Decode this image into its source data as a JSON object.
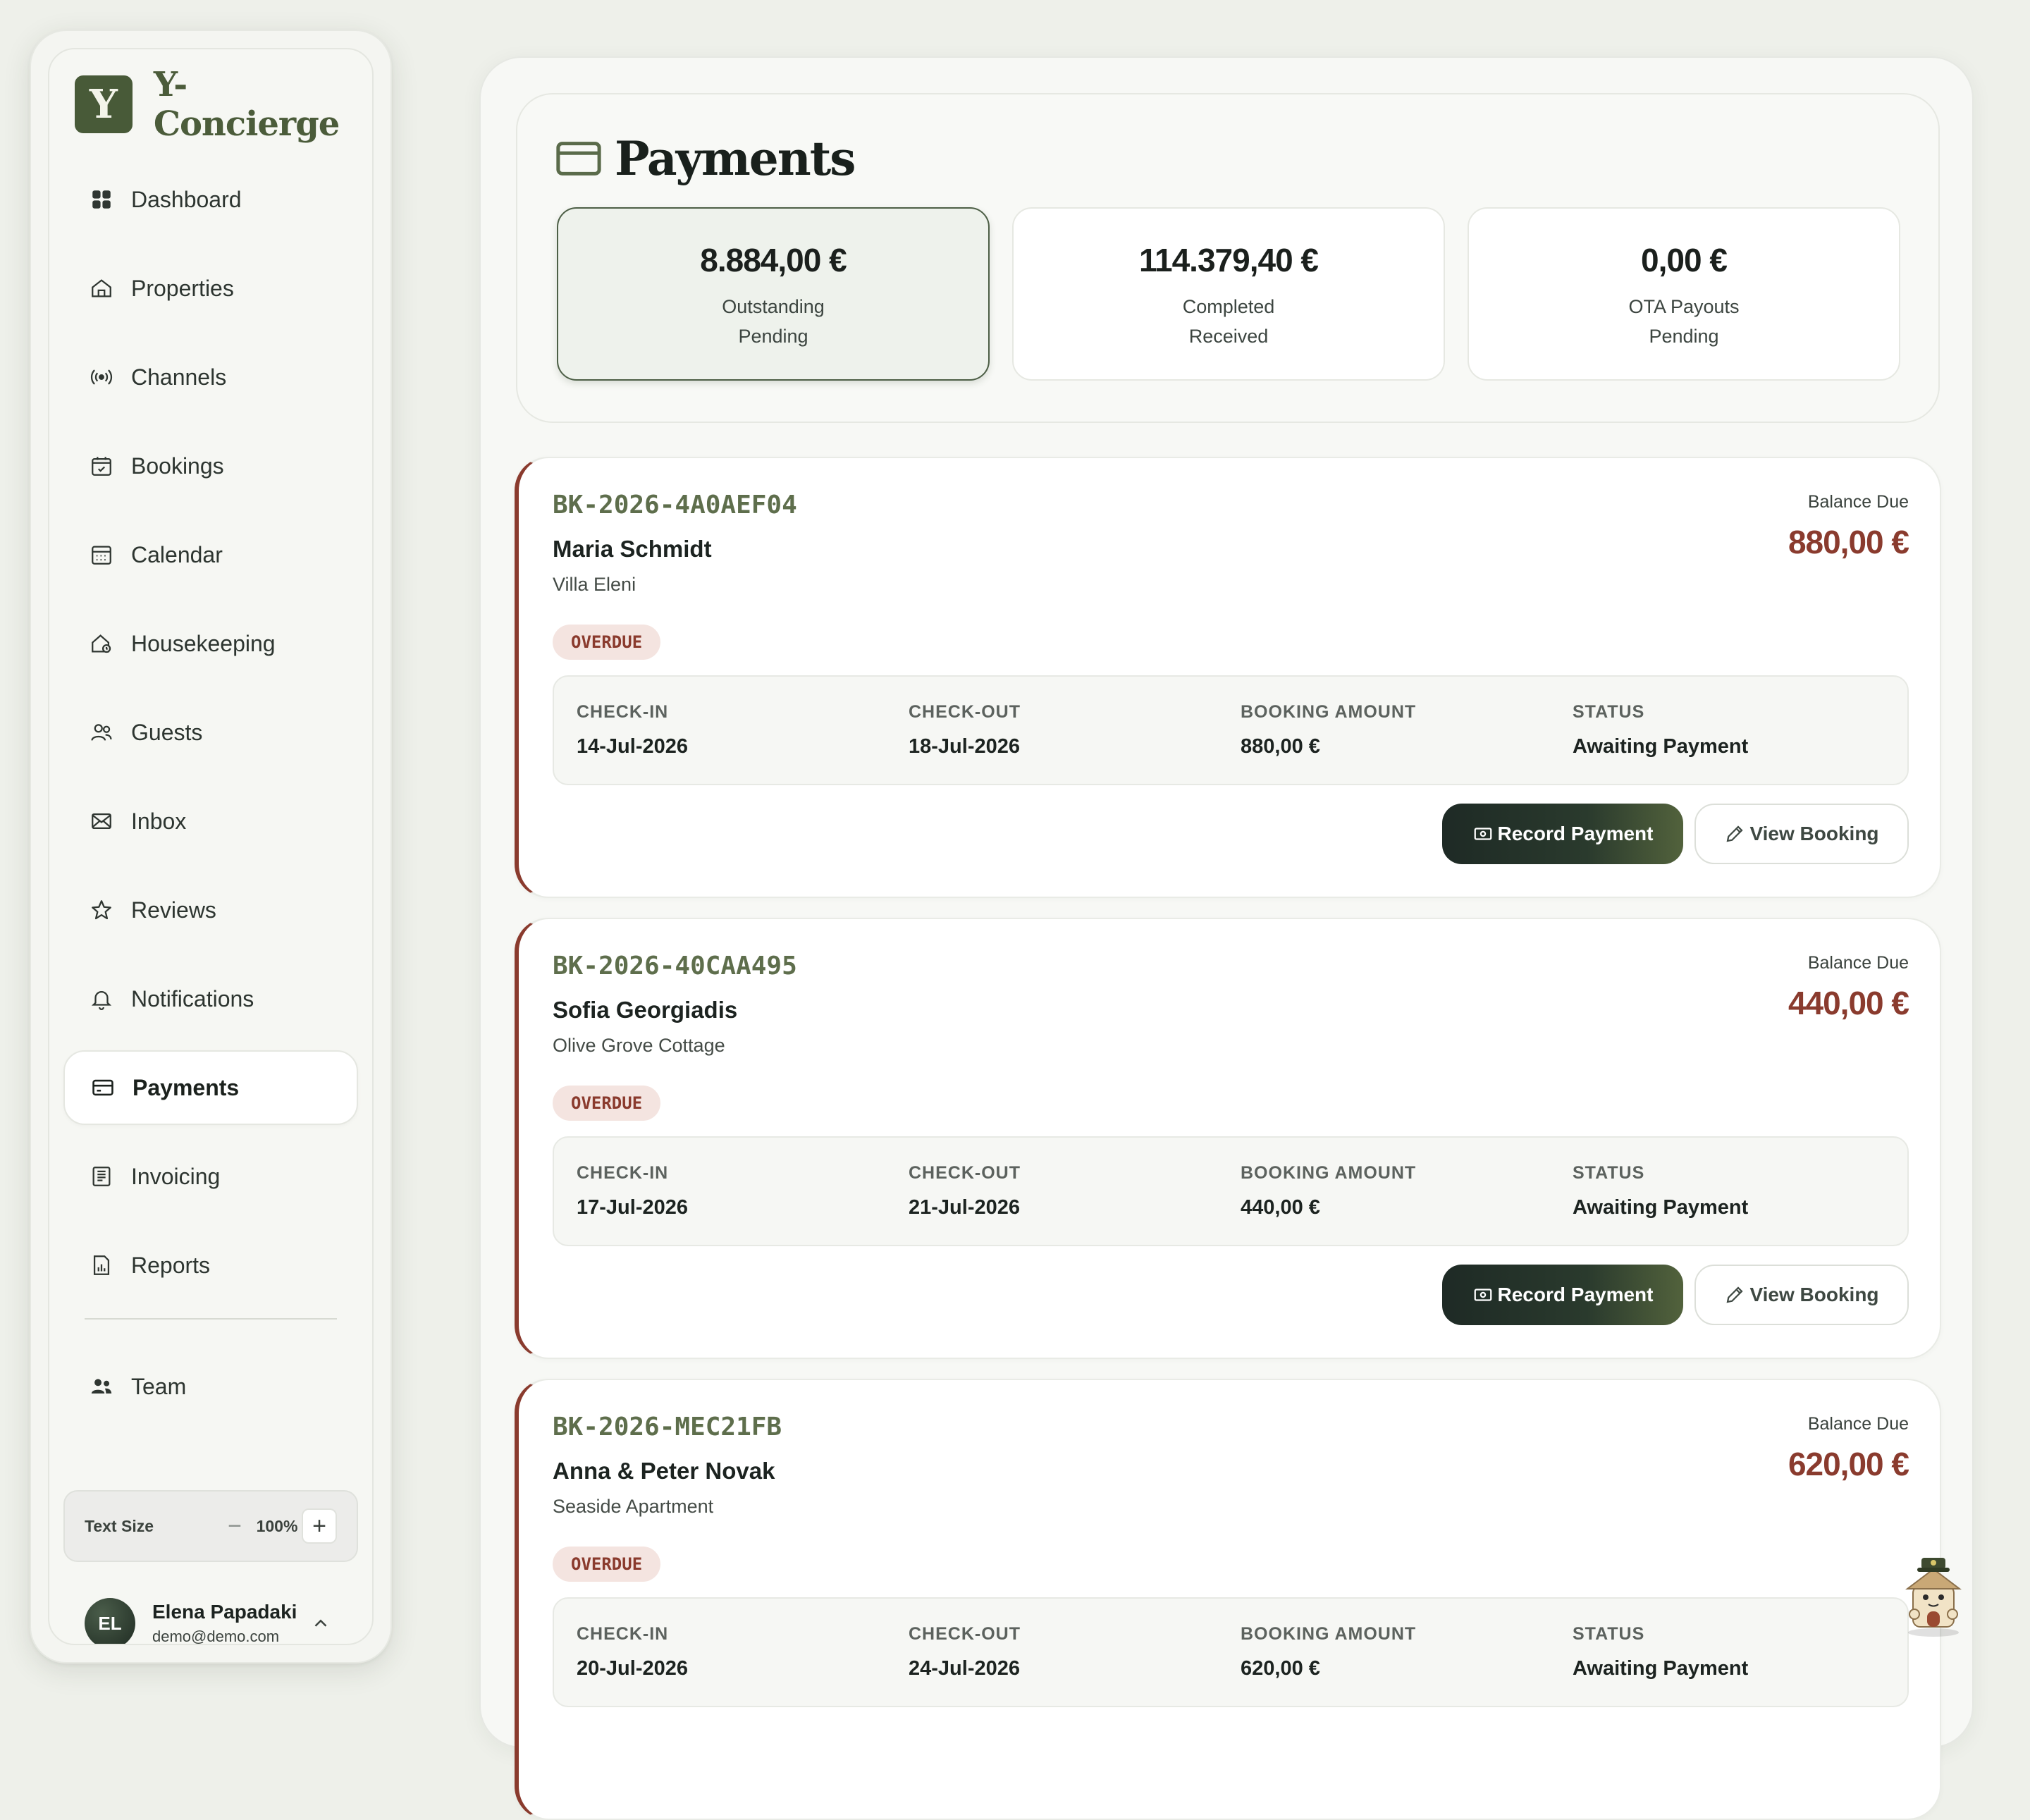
{
  "brand": {
    "logo_letter": "Y",
    "name": "Y-Concierge",
    "color": "#485a38"
  },
  "sidebar": {
    "items": [
      {
        "label": "Dashboard",
        "icon": "dashboard-icon"
      },
      {
        "label": "Properties",
        "icon": "home-icon"
      },
      {
        "label": "Channels",
        "icon": "broadcast-icon"
      },
      {
        "label": "Bookings",
        "icon": "calendar-check-icon"
      },
      {
        "label": "Calendar",
        "icon": "calendar-icon"
      },
      {
        "label": "Housekeeping",
        "icon": "housekeeping-icon"
      },
      {
        "label": "Guests",
        "icon": "users-icon"
      },
      {
        "label": "Inbox",
        "icon": "mail-icon"
      },
      {
        "label": "Reviews",
        "icon": "star-icon"
      },
      {
        "label": "Notifications",
        "icon": "bell-icon"
      },
      {
        "label": "Payments",
        "icon": "credit-card-icon",
        "active": true
      },
      {
        "label": "Invoicing",
        "icon": "invoice-icon"
      },
      {
        "label": "Reports",
        "icon": "report-icon"
      },
      {
        "label": "Team",
        "icon": "team-icon"
      }
    ],
    "text_size": {
      "label": "Text Size",
      "value": "100%",
      "minus": "−",
      "plus": "+"
    },
    "user": {
      "initials": "EL",
      "name": "Elena Papadaki",
      "email": "demo@demo.com"
    }
  },
  "page": {
    "title": "Payments"
  },
  "stats": [
    {
      "value": "8.884,00 €",
      "label1": "Outstanding",
      "label2": "Pending"
    },
    {
      "value": "114.379,40 €",
      "label1": "Completed",
      "label2": "Received"
    },
    {
      "value": "0,00 €",
      "label1": "OTA Payouts",
      "label2": "Pending"
    }
  ],
  "labels": {
    "balance_due": "Balance Due",
    "check_in": "CHECK-IN",
    "check_out": "CHECK-OUT",
    "booking_amount": "BOOKING AMOUNT",
    "status": "STATUS",
    "record_payment": "Record Payment",
    "view_booking": "View Booking"
  },
  "bookings": [
    {
      "ref": "BK-2026-4A0AEF04",
      "guest": "Maria Schmidt",
      "property": "Villa Eleni",
      "badge": "OVERDUE",
      "balance": "880,00 €",
      "check_in": "14-Jul-2026",
      "check_out": "18-Jul-2026",
      "amount": "880,00 €",
      "status": "Awaiting Payment"
    },
    {
      "ref": "BK-2026-40CAA495",
      "guest": "Sofia Georgiadis",
      "property": "Olive Grove Cottage",
      "badge": "OVERDUE",
      "balance": "440,00 €",
      "check_in": "17-Jul-2026",
      "check_out": "21-Jul-2026",
      "amount": "440,00 €",
      "status": "Awaiting Payment"
    },
    {
      "ref": "BK-2026-MEC21FB",
      "guest": "Anna & Peter Novak",
      "property": "Seaside Apartment",
      "badge": "OVERDUE",
      "balance": "620,00 €",
      "check_in": "20-Jul-2026",
      "check_out": "24-Jul-2026",
      "amount": "620,00 €",
      "status": "Awaiting Payment"
    }
  ],
  "colors": {
    "accent": "#4b5c3a",
    "overdue": "#8a3b2e",
    "background": "#eef0ea"
  }
}
